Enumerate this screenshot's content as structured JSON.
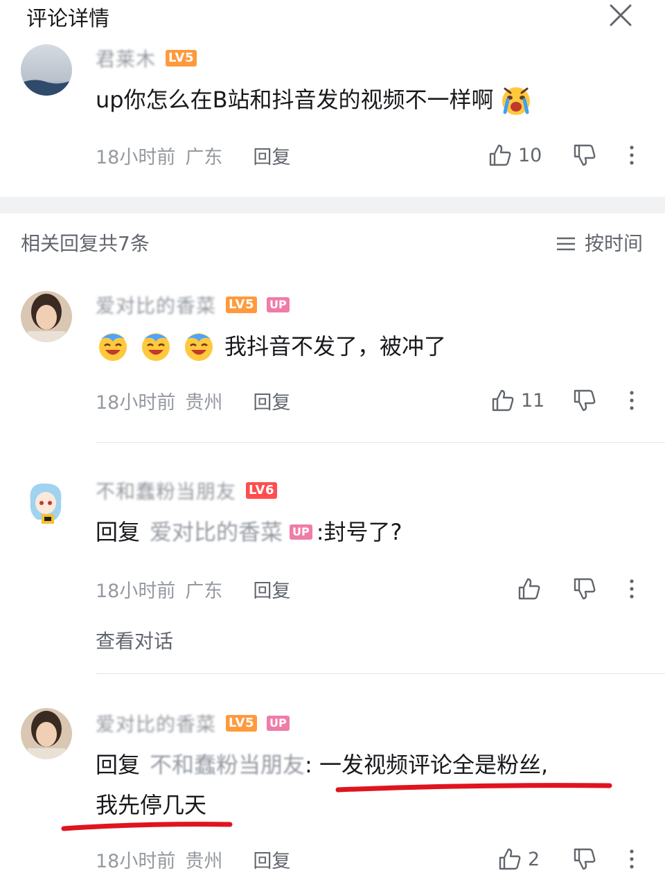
{
  "header": {
    "title": "评论详情"
  },
  "root_comment": {
    "username": "君莱木",
    "level": "LV5",
    "content": "up你怎么在B站和抖音发的视频不一样啊",
    "time": "18小时前",
    "region": "广东",
    "reply_label": "回复",
    "like_count": "10"
  },
  "replies_header": {
    "count_label": "相关回复共7条",
    "sort_label": "按时间"
  },
  "replies": [
    {
      "username": "爱对比的香菜",
      "level": "LV5",
      "badge": "UP",
      "content": "我抖音不发了，被冲了",
      "time": "18小时前",
      "region": "贵州",
      "reply_label": "回复",
      "like_count": "11"
    },
    {
      "username": "不和蠢粉当朋友",
      "level": "LV6",
      "reply_prefix": "回复",
      "mention": "爱对比的香菜",
      "mention_badge": "UP",
      "content": ":封号了?",
      "time": "18小时前",
      "region": "广东",
      "reply_label": "回复",
      "like_count": "",
      "view_conversation": "查看对话"
    },
    {
      "username": "爱对比的香菜",
      "level": "LV5",
      "badge": "UP",
      "reply_prefix": "回复",
      "mention": "不和蠢粉当朋友",
      "content_line1": ": 一发视频评论全是粉丝,",
      "content_line2": "我先停几天",
      "time": "18小时前",
      "region": "贵州",
      "reply_label": "回复",
      "like_count": "2"
    }
  ],
  "colors": {
    "muted": "#9499a0",
    "text": "#18191c",
    "level5": "#ff9a3c",
    "level6": "#ff4d4f",
    "up_badge": "#f07ca8",
    "annotation": "#e0141e"
  }
}
